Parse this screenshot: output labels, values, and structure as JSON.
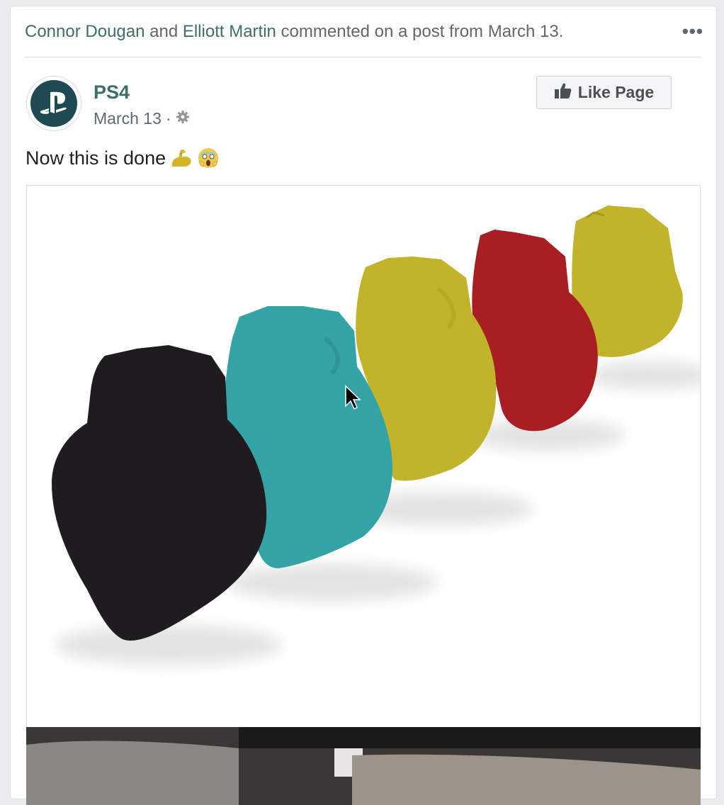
{
  "story": {
    "actor1": "Connor Dougan",
    "and": " and ",
    "actor2": "Elliott Martin",
    "action": " commented on a post from March 13.",
    "more": "•••"
  },
  "post": {
    "page_name": "PS4",
    "date": "March 13",
    "separator": "·",
    "text": "Now this is done",
    "like_page_label": "Like Page"
  },
  "icons": {
    "avatar": "playstation-logo-icon",
    "privacy": "gear-icon",
    "like": "thumbs-up-icon",
    "emoji1": "flexed-biceps-icon",
    "emoji2": "face-screaming-icon",
    "cursor": "mouse-pointer-icon"
  },
  "colors": {
    "link": "#3b6f6a",
    "controller_black": "#1e1c1f",
    "controller_teal": "#33a3a6",
    "controller_yellow": "#c2b42a",
    "controller_red": "#a81e22"
  }
}
